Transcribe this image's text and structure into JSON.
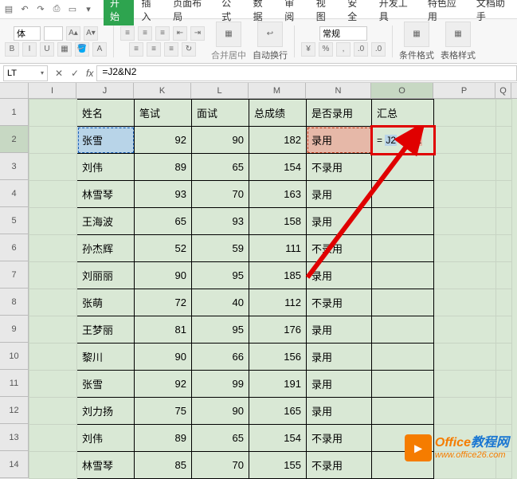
{
  "ribbon": {
    "tabs": [
      "开始",
      "插入",
      "页面布局",
      "公式",
      "数据",
      "审阅",
      "视图",
      "安全",
      "开发工具",
      "特色应用",
      "文档助手"
    ],
    "active_tab": "开始",
    "font_box": "体",
    "merge_label": "合并居中",
    "wrap_label": "自动换行",
    "numfmt": "常规",
    "cond_fmt": "条件格式",
    "cell_style": "表格样式"
  },
  "formula_bar": {
    "name_box": "LT",
    "formula": "=J2&N2"
  },
  "inline_formula": {
    "eq": "=",
    "j": "J2",
    "amp": " & ",
    "n": "N2"
  },
  "columns": [
    "I",
    "J",
    "K",
    "L",
    "M",
    "N",
    "O",
    "P",
    "Q"
  ],
  "headers": {
    "J": "姓名",
    "K": "笔试",
    "L": "面试",
    "M": "总成绩",
    "N": "是否录用",
    "O": "汇总"
  },
  "chart_data": {
    "type": "table",
    "columns": [
      "姓名",
      "笔试",
      "面试",
      "总成绩",
      "是否录用"
    ],
    "rows": [
      {
        "name": "张雪",
        "written": 92,
        "interview": 90,
        "total": 182,
        "hire": "录用"
      },
      {
        "name": "刘伟",
        "written": 89,
        "interview": 65,
        "total": 154,
        "hire": "不录用"
      },
      {
        "name": "林雪琴",
        "written": 93,
        "interview": 70,
        "total": 163,
        "hire": "录用"
      },
      {
        "name": "王海波",
        "written": 65,
        "interview": 93,
        "total": 158,
        "hire": "录用"
      },
      {
        "name": "孙杰辉",
        "written": 52,
        "interview": 59,
        "total": 111,
        "hire": "不录用"
      },
      {
        "name": "刘丽丽",
        "written": 90,
        "interview": 95,
        "total": 185,
        "hire": "录用"
      },
      {
        "name": "张萌",
        "written": 72,
        "interview": 40,
        "total": 112,
        "hire": "不录用"
      },
      {
        "name": "王梦丽",
        "written": 81,
        "interview": 95,
        "total": 176,
        "hire": "录用"
      },
      {
        "name": "黎川",
        "written": 90,
        "interview": 66,
        "total": 156,
        "hire": "录用"
      },
      {
        "name": "张雪",
        "written": 92,
        "interview": 99,
        "total": 191,
        "hire": "录用"
      },
      {
        "name": "刘力扬",
        "written": 75,
        "interview": 90,
        "total": 165,
        "hire": "录用"
      },
      {
        "name": "刘伟",
        "written": 89,
        "interview": 65,
        "total": 154,
        "hire": "不录用"
      },
      {
        "name": "林雪琴",
        "written": 85,
        "interview": 70,
        "total": 155,
        "hire": "不录用"
      }
    ]
  },
  "watermark": {
    "brand1": "Office",
    "brand2": "教程网",
    "url": "www.office26.com"
  }
}
